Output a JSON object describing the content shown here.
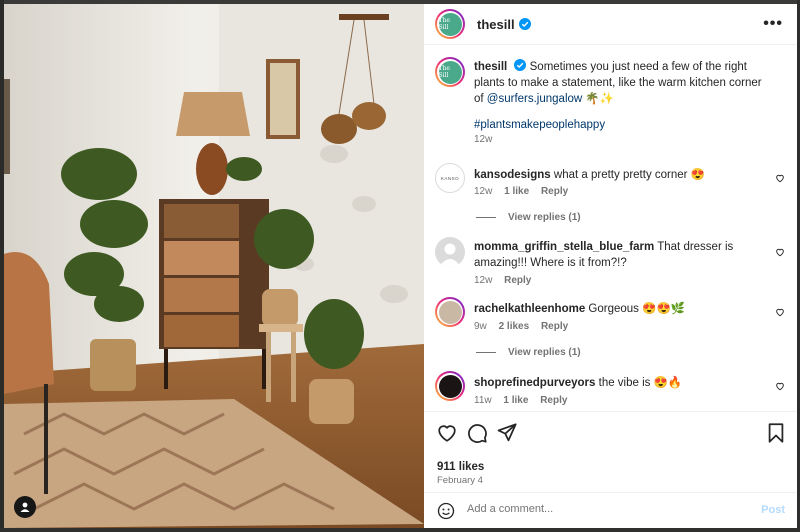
{
  "post": {
    "username": "thesill",
    "avatar_text": "The Sill",
    "more_label": "•••",
    "caption_user": "thesill",
    "caption_text": "Sometimes you just need a few of the right plants to make a statement, like the warm kitchen corner of",
    "caption_mention": "@surfers.jungalow",
    "caption_emoji": "🌴✨",
    "hashtag": "#plantsmakepeoplehappy",
    "caption_time": "12w"
  },
  "comments": [
    {
      "user": "kansodesigns",
      "text": "what a pretty pretty corner 😍",
      "time": "12w",
      "likes": "1 like",
      "reply": "Reply",
      "view_replies": "View replies (1)",
      "avatar_text": "KANSO"
    },
    {
      "user": "momma_griffin_stella_blue_farm",
      "text": "That dresser is amazing!!! Where is it from?!?",
      "time": "12w",
      "likes": "",
      "reply": "Reply",
      "view_replies": ""
    },
    {
      "user": "rachelkathleenhome",
      "text": "Gorgeous 😍😍🌿",
      "time": "9w",
      "likes": "2 likes",
      "reply": "Reply",
      "view_replies": "View replies (1)"
    },
    {
      "user": "shoprefinedpurveyors",
      "text": "the vibe is 😍🔥",
      "time": "11w",
      "likes": "1 like",
      "reply": "Reply",
      "view_replies": ""
    }
  ],
  "footer": {
    "likes": "911 likes",
    "date": "February 4",
    "comment_placeholder": "Add a comment...",
    "post_label": "Post"
  },
  "icons": {
    "verified": "verified-badge-icon",
    "heart": "heart-icon",
    "comment": "comment-icon",
    "share": "share-icon",
    "save": "bookmark-icon",
    "emoji": "emoji-icon",
    "more": "more-options-icon",
    "tag": "user-tag-icon"
  },
  "colors": {
    "verified_blue": "#0095f6",
    "link": "#00376b",
    "muted": "#737373",
    "post_disabled": "#b3dbff",
    "brand_avatar": "#4aa88b"
  }
}
